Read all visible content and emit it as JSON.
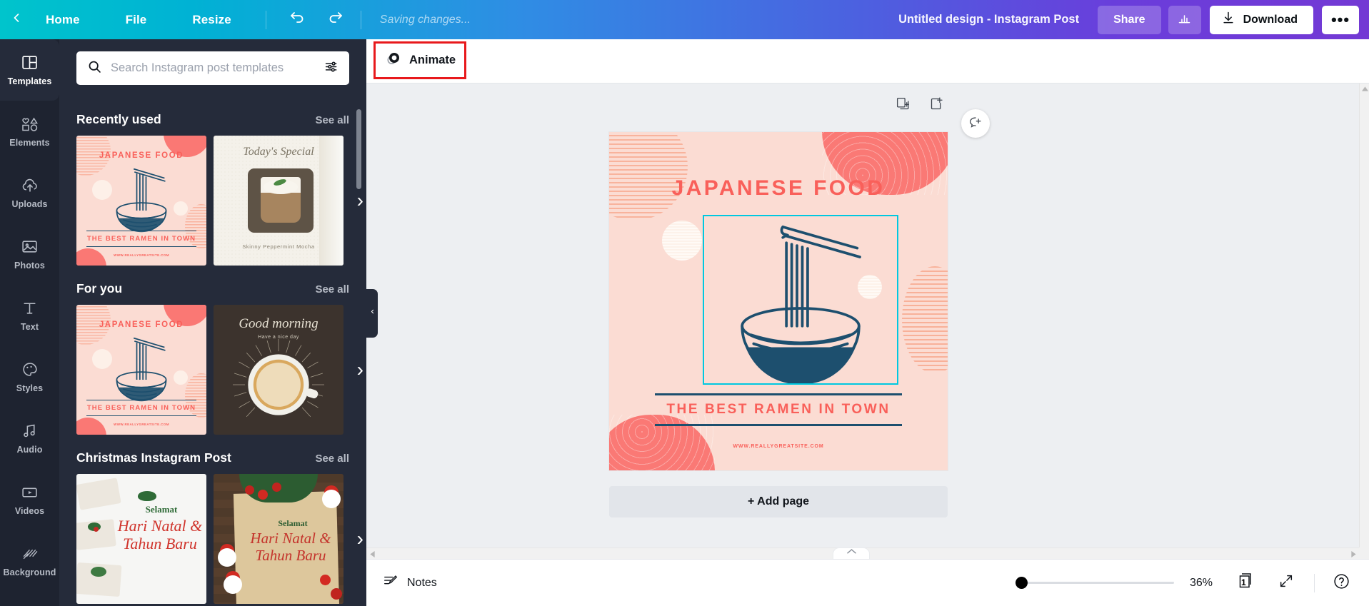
{
  "topbar": {
    "back_icon": "chevron-left-icon",
    "home_label": "Home",
    "file_label": "File",
    "resize_label": "Resize",
    "undo_icon": "undo-icon",
    "redo_icon": "redo-icon",
    "saving_status": "Saving changes...",
    "design_title": "Untitled design - Instagram Post",
    "share_label": "Share",
    "stats_icon": "bar-chart-icon",
    "download_label": "Download",
    "download_icon": "download-icon",
    "more_label": "•••"
  },
  "rail": {
    "items": [
      {
        "label": "Templates",
        "icon": "templates-icon",
        "active": true
      },
      {
        "label": "Elements",
        "icon": "elements-icon",
        "active": false
      },
      {
        "label": "Uploads",
        "icon": "upload-cloud-icon",
        "active": false
      },
      {
        "label": "Photos",
        "icon": "photo-icon",
        "active": false
      },
      {
        "label": "Text",
        "icon": "text-icon",
        "active": false
      },
      {
        "label": "Styles",
        "icon": "palette-icon",
        "active": false
      },
      {
        "label": "Audio",
        "icon": "music-note-icon",
        "active": false
      },
      {
        "label": "Videos",
        "icon": "video-icon",
        "active": false
      },
      {
        "label": "Background",
        "icon": "background-icon",
        "active": false
      }
    ]
  },
  "panel": {
    "search": {
      "placeholder": "Search Instagram post templates",
      "value": "",
      "search_icon": "search-icon",
      "filter_icon": "filter-sliders-icon"
    },
    "see_all_label": "See all",
    "next_arrow": "›",
    "sections": [
      {
        "title": "Recently used",
        "templates": [
          {
            "name": "japanese-food-ramen",
            "style": "t-ramen",
            "title": "JAPANESE FOOD",
            "subtitle": "THE BEST RAMEN IN TOWN",
            "url": "WWW.REALLYGREATSITE.COM"
          },
          {
            "name": "todays-special-mocha",
            "style": "t-matcha",
            "title": "Today's Special",
            "subtitle": "Skinny Peppermint Mocha",
            "url": ""
          }
        ]
      },
      {
        "title": "For you",
        "templates": [
          {
            "name": "japanese-food-ramen",
            "style": "t-ramen",
            "title": "JAPANESE FOOD",
            "subtitle": "THE BEST RAMEN IN TOWN",
            "url": "WWW.REALLYGREATSITE.COM"
          },
          {
            "name": "good-morning-coffee",
            "style": "t-coffee",
            "title": "Good morning",
            "subtitle": "Have a nice day",
            "url": ""
          }
        ]
      },
      {
        "title": "Christmas Instagram Post",
        "templates": [
          {
            "name": "hari-natal-gifts",
            "style": "t-xmas1",
            "title": "Selamat",
            "subtitle": "Hari Natal & Tahun Baru",
            "url": ""
          },
          {
            "name": "hari-natal-santa",
            "style": "t-xmas2",
            "title": "Selamat",
            "subtitle": "Hari Natal & Tahun Baru",
            "url": ""
          }
        ]
      }
    ]
  },
  "toolbar": {
    "animate_label": "Animate",
    "animate_icon": "animate-circles-icon",
    "highlight_color": "#e8191c"
  },
  "canvas": {
    "duplicate_icon": "duplicate-page-icon",
    "addpage_icon": "add-page-icon",
    "comment_icon": "add-comment-icon",
    "add_page_label": "+ Add page",
    "design": {
      "title": "JAPANESE FOOD",
      "subtitle": "THE BEST RAMEN IN TOWN",
      "url": "WWW.REALLYGREATSITE.COM",
      "bg_color": "#fbdcd3",
      "accent_color": "#f9605a",
      "ink_color": "#1d4f6e",
      "selection_color": "#00c8e0"
    }
  },
  "bottombar": {
    "notes_label": "Notes",
    "notes_icon": "notes-icon",
    "zoom_percent": "36%",
    "page_count": "1",
    "pages_icon": "pages-icon",
    "fullscreen_icon": "expand-icon",
    "help_icon": "help-circle-icon"
  }
}
